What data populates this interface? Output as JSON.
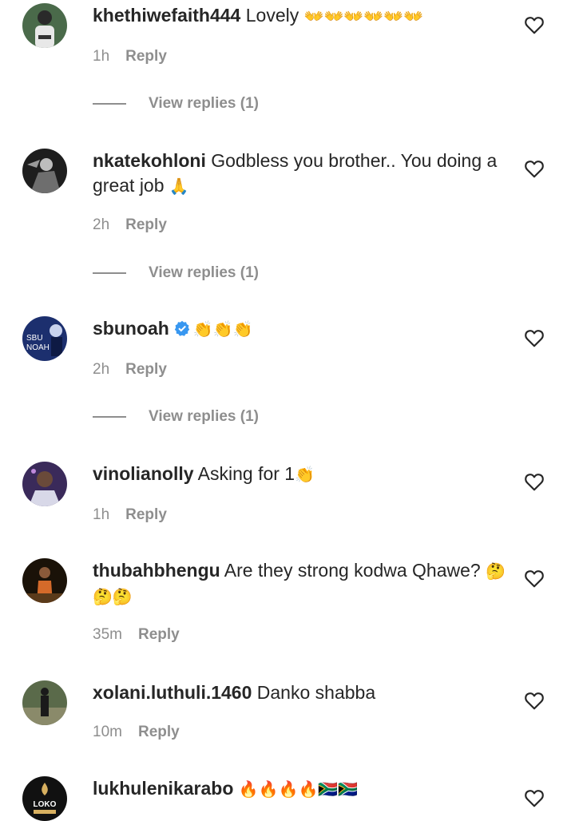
{
  "comments": [
    {
      "username": "khethiwefaith444",
      "text": " Lovely ",
      "emoji": "👐👐👐👐👐👐",
      "time": "1h",
      "reply": "Reply",
      "view_replies": "View replies (1)",
      "avatar_bg": "#3a5a3a"
    },
    {
      "username": "nkatekohloni",
      "text": " Godbless you brother.. You doing a great job ",
      "emoji": "🙏",
      "time": "2h",
      "reply": "Reply",
      "view_replies": "View replies (1)",
      "avatar_bg": "#2b2b2b"
    },
    {
      "username": "sbunoah",
      "text": "",
      "emoji": "👏👏👏",
      "verified": true,
      "time": "2h",
      "reply": "Reply",
      "view_replies": "View replies (1)",
      "avatar_bg": "#1c2f6e",
      "avatar_text": "SBU NOAH"
    },
    {
      "username": "vinolianolly",
      "text": " Asking for 1",
      "emoji": "👏",
      "time": "1h",
      "reply": "Reply",
      "avatar_bg": "#4a3a6a"
    },
    {
      "username": "thubahbhengu",
      "text": " Are they strong kodwa Qhawe? ",
      "emoji": "🤔🤔🤔",
      "time": "35m",
      "reply": "Reply",
      "avatar_bg": "#7a4a2a"
    },
    {
      "username": "xolani.luthuli.1460",
      "text": " Danko shabba",
      "emoji": "",
      "time": "10m",
      "reply": "Reply",
      "avatar_bg": "#4a5a3a"
    },
    {
      "username": "lukhulenikarabo",
      "text": " ",
      "emoji": "🔥🔥🔥🔥🇿🇦🇿🇦",
      "time": "",
      "reply": "",
      "avatar_bg": "#111111",
      "avatar_text": "LOKO"
    }
  ],
  "colors": {
    "text": "#262626",
    "muted": "#8e8e8e",
    "verified": "#3897f0"
  }
}
